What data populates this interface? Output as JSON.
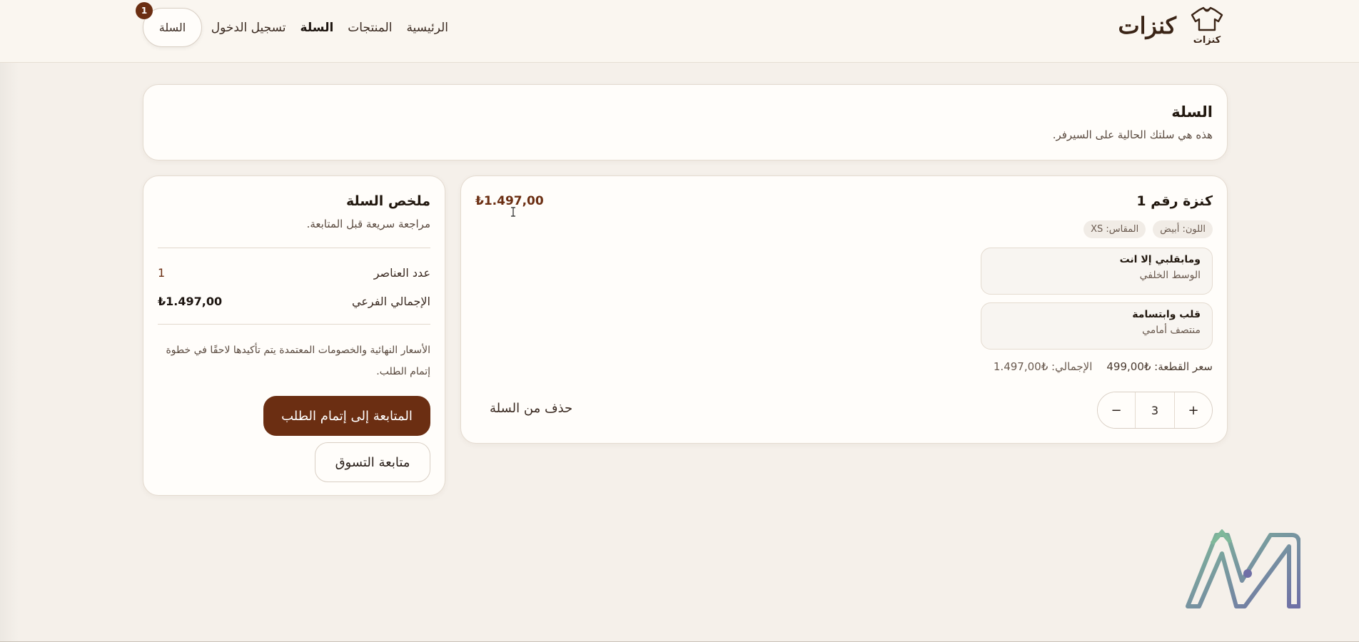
{
  "header": {
    "brand_name": "كنزات",
    "logo_text": "كنزات",
    "nav": [
      "الرئيسية",
      "المنتجات",
      "السلة",
      "تسجيل الدخول"
    ],
    "active_nav": "السلة",
    "cart_button": "السلة",
    "cart_count": "1"
  },
  "page": {
    "title": "السلة",
    "subtitle": "هذه هي سلتك الحالية على السيرفر."
  },
  "item": {
    "name": "كنزة رقم 1",
    "price": "₺1.497,00",
    "chips": [
      "اللون: أبيض",
      "المقاس: XS"
    ],
    "designs": [
      {
        "name": "ومابقلبي إلا انت",
        "position": "الوسط الخلفي"
      },
      {
        "name": "قلب وابتسامة",
        "position": "منتصف أمامي"
      }
    ],
    "unit_price": "سعر القطعة: ₺499,00",
    "total_line": "الإجمالي: ₺1.497,00",
    "quantity": "3",
    "minus": "−",
    "plus": "+",
    "remove": "حذف من السلة"
  },
  "summary": {
    "title": "ملخص السلة",
    "subtitle": "مراجعة سريعة قبل المتابعة.",
    "items_label": "عدد العناصر",
    "items_value": "1",
    "subtotal_label": "الإجمالي الفرعي",
    "subtotal_value": "₺1.497,00",
    "note": "الأسعار النهائية والخصومات المعتمدة يتم تأكيدها لاحقًا في خطوة إتمام الطلب.",
    "checkout": "المتابعة إلى إتمام الطلب",
    "continue": "متابعة التسوق"
  },
  "colors": {
    "accent": "#6b2e12",
    "background": "#f5f0ea",
    "card": "#fffdfa"
  },
  "icons": {
    "logo": "sweater-icon",
    "watermark": "m-logo-icon",
    "cursor": "text-cursor-icon"
  }
}
